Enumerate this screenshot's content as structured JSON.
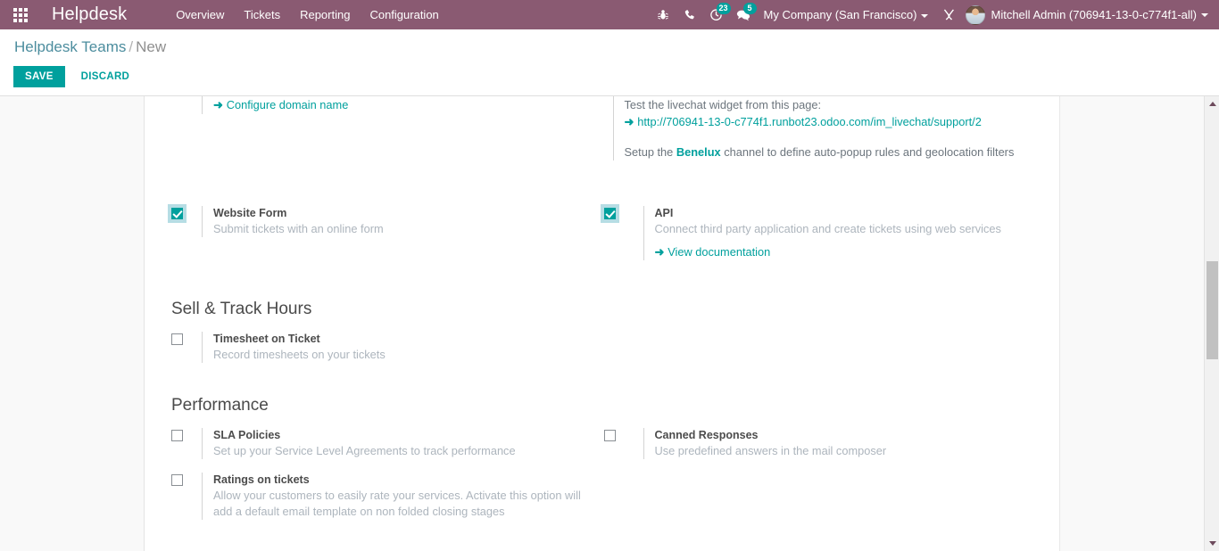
{
  "navbar": {
    "apps_icon": "apps-grid-icon",
    "brand": "Helpdesk",
    "menu": [
      {
        "label": "Overview"
      },
      {
        "label": "Tickets"
      },
      {
        "label": "Reporting"
      },
      {
        "label": "Configuration"
      }
    ],
    "icons": [
      {
        "name": "bug-icon",
        "badge": null
      },
      {
        "name": "phone-icon",
        "badge": null
      },
      {
        "name": "clock-activity-icon",
        "badge": "23"
      },
      {
        "name": "messages-icon",
        "badge": "5"
      }
    ],
    "company": "My Company (San Francisco)",
    "debug_icon": "wrench-screwdriver-icon",
    "user": "Mitchell Admin (706941-13-0-c774f1-all)"
  },
  "breadcrumb": {
    "parent": "Helpdesk Teams",
    "separator": "/",
    "current": "New"
  },
  "toolbar": {
    "save_label": "SAVE",
    "discard_label": "DISCARD"
  },
  "settings": {
    "email_domain_link": "Configure domain name",
    "livechat": {
      "intro": "Test the livechat widget from this page:",
      "url": "http://706941-13-0-c774f1.runbot23.odoo.com/im_livechat/support/2",
      "setup_prefix": "Setup the",
      "setup_channel": "Benelux",
      "setup_suffix": "channel to define auto-popup rules and geolocation filters"
    },
    "website_form": {
      "title": "Website Form",
      "desc": "Submit tickets with an online form",
      "checked": true
    },
    "api": {
      "title": "API",
      "desc": "Connect third party application and create tickets using web services",
      "link": "View documentation",
      "checked": true
    },
    "sell_track_hours": {
      "section_title": "Sell & Track Hours",
      "timesheet": {
        "title": "Timesheet on Ticket",
        "desc": "Record timesheets on your tickets",
        "checked": false
      }
    },
    "performance": {
      "section_title": "Performance",
      "sla": {
        "title": "SLA Policies",
        "desc": "Set up your Service Level Agreements to track performance",
        "checked": false
      },
      "ratings": {
        "title": "Ratings on tickets",
        "desc": "Allow your customers to easily rate your services. Activate this option will add a default email template on non folded closing stages",
        "checked": false
      },
      "canned": {
        "title": "Canned Responses",
        "desc": "Use predefined answers in the mail composer",
        "checked": false
      }
    }
  },
  "colors": {
    "navbar": "#8a5a72",
    "accent": "#00A09D",
    "link": "#4c8d9e",
    "muted": "#adb5bd"
  }
}
